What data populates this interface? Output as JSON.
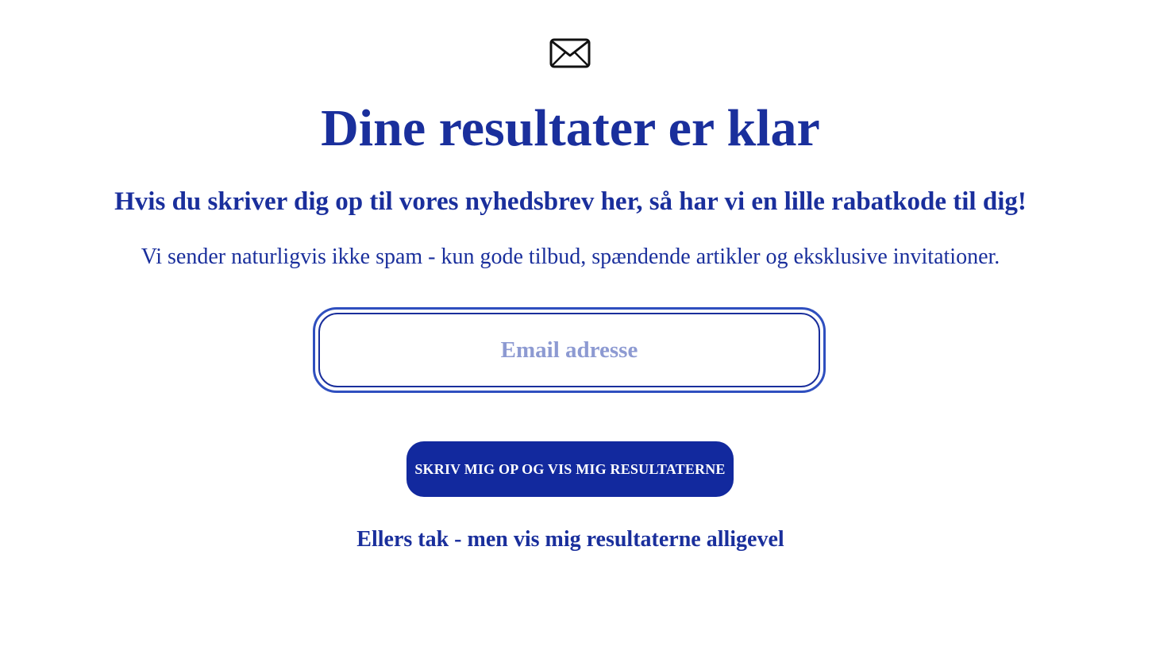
{
  "icon": "mail-icon",
  "title": "Dine resultater er klar",
  "subtitle": "Hvis du skriver dig op til vores nyhedsbrev her, så har vi en lille rabatkode til dig!",
  "description": "Vi sender naturligvis ikke spam - kun gode tilbud, spændende artikler og eksklusive invitationer.",
  "email": {
    "value": "",
    "placeholder": "Email adresse"
  },
  "submit_label": "SKRIV MIG OP OG VIS MIG RESULTATERNE",
  "skip_label": "Ellers tak - men vis mig resultaterne alligevel",
  "colors": {
    "primary": "#1a2f9c",
    "button": "#12299e",
    "placeholder": "#8d9ad2",
    "background": "#ffffff"
  }
}
